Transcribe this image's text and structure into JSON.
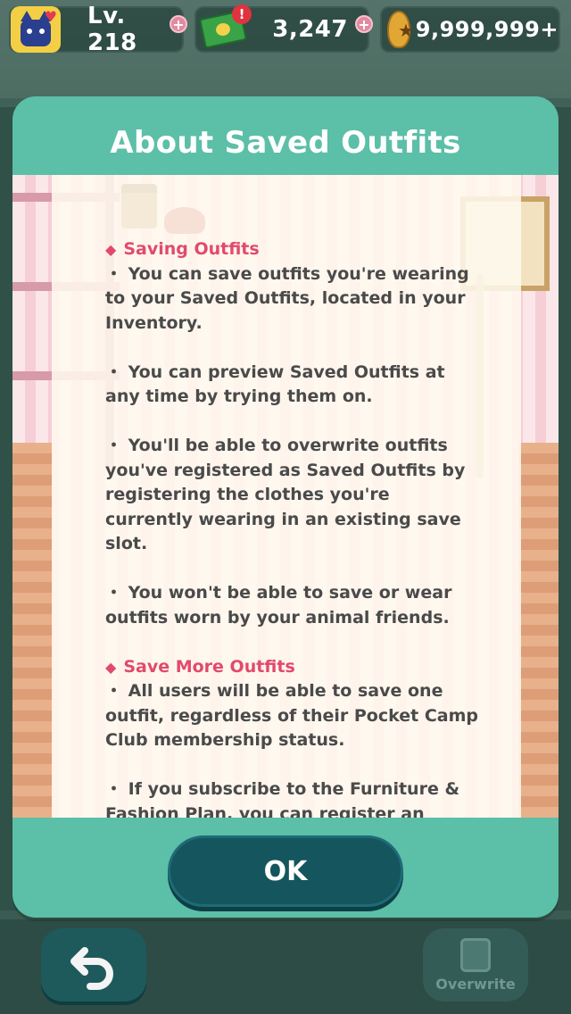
{
  "status_bar": {
    "level": "Lv. 218",
    "tickets": "3,247",
    "bells": "9,999,999+",
    "plus_symbol": "+",
    "alert_symbol": "!",
    "icons": [
      "cat-avatar-icon",
      "heart-icon",
      "leaf-ticket-icon",
      "bell-bag-icon"
    ]
  },
  "modal": {
    "title": "About Saved Outfits",
    "sections": [
      {
        "heading": "Saving Outfits",
        "paragraphs": [
          "・ You can save outfits you're wearing to your Saved Outfits, located in your Inventory.",
          "・ You can preview Saved Outfits at any time by trying them on.",
          "・ You'll be able to overwrite outfits you've registered as Saved Outfits by registering the clothes you're currently wearing in an existing save slot.",
          "・ You won't be able to save or wear outfits worn by your animal friends."
        ]
      },
      {
        "heading": "Save More Outfits",
        "paragraphs": [
          "・ All users will be able to save one outfit, regardless of their Pocket Camp Club membership status.",
          "・ If you subscribe to the Furniture & Fashion Plan, you can register an additional ten Saved Outfits,"
        ]
      }
    ],
    "ok_label": "OK"
  },
  "bottom_bar": {
    "overwrite_label": "Overwrite",
    "back_icon": "back-arrow-icon"
  },
  "colors": {
    "modal_teal": "#5cbfa8",
    "heading_pink": "#e14a6b",
    "button_dark_teal": "#15555e"
  }
}
